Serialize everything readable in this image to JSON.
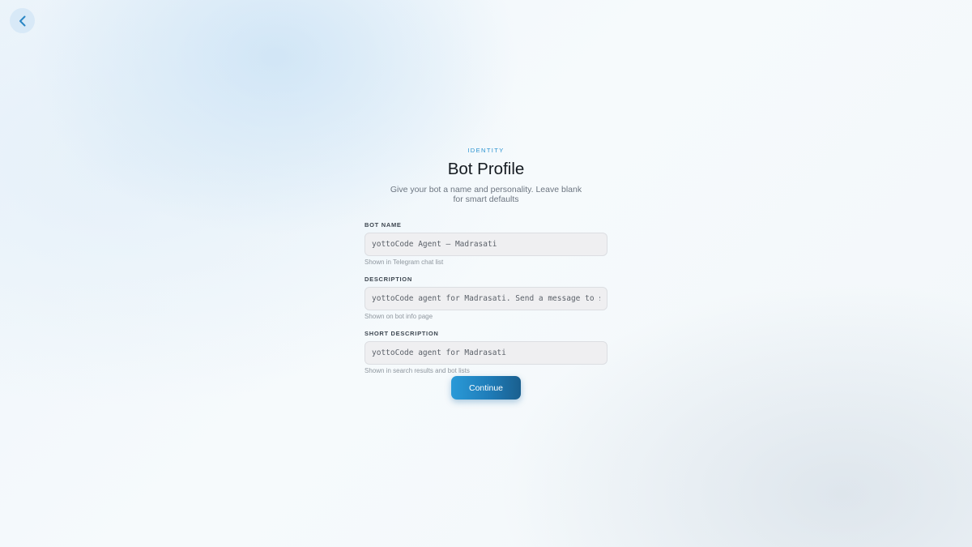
{
  "nav": {
    "back_icon": "chevron-left-icon"
  },
  "header": {
    "eyebrow": "IDENTITY",
    "title": "Bot Profile",
    "subtitle": "Give your bot a name and personality. Leave blank for smart defaults"
  },
  "form": {
    "fields": [
      {
        "label": "BOT NAME",
        "placeholder": "yottoCode Agent — Madrasati",
        "value": "",
        "hint": "Shown in Telegram chat list"
      },
      {
        "label": "DESCRIPTION",
        "placeholder": "yottoCode agent for Madrasati. Send a message to start",
        "value": "",
        "hint": "Shown on bot info page"
      },
      {
        "label": "SHORT DESCRIPTION",
        "placeholder": "yottoCode agent for Madrasati",
        "value": "",
        "hint": "Shown in search results and bot lists"
      }
    ],
    "submit_label": "Continue"
  },
  "colors": {
    "accent": "#2b93d0",
    "button_gradient_start": "#2a9ad8",
    "button_gradient_end": "#1a5f8e",
    "title": "#141a20",
    "input_bg": "#efeff1"
  }
}
